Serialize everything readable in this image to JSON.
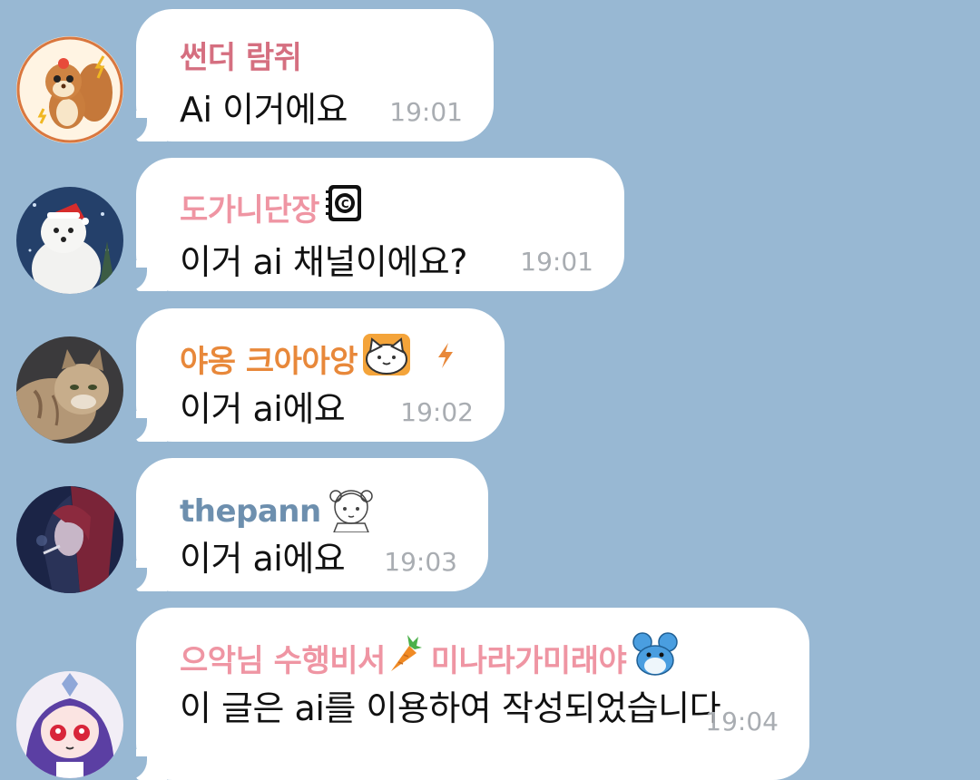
{
  "colors": {
    "background": "#98b8d3",
    "bubble": "#ffffff",
    "time": "#a9adb2",
    "sender_pink_dark": "#d56f80",
    "sender_pink_light": "#ef95a3",
    "sender_orange": "#e8883a",
    "sender_blue": "#6d8fae"
  },
  "messages": [
    {
      "sender": "썬더 람쥐",
      "sender_color": "#d56f80",
      "avatar": "squirrel-avatar",
      "text": "Ai 이거에요",
      "time": "19:01"
    },
    {
      "sender": "도가니단장",
      "sender_color": "#ef95a3",
      "avatar": "white-dog-avatar",
      "sender_emoji": "coin-notebook-icon",
      "text": "이거 ai 채널이에요?",
      "time": "19:01"
    },
    {
      "sender": "야옹 크아아앙",
      "sender_color": "#e8883a",
      "avatar": "cat-photo-avatar",
      "sender_emoji": "cat-face-icon",
      "sender_extra": "lightning-icon",
      "text": "이거 ai에요",
      "time": "19:02"
    },
    {
      "sender": "thepann",
      "sender_color": "#6d8fae",
      "avatar": "anime-girl-avatar",
      "sender_emoji": "sketch-girl-icon",
      "text": "이거 ai에요",
      "time": "19:03"
    },
    {
      "sender": "으악님 수행비서",
      "sender_color": "#ef95a3",
      "sender_emoji": "carrot-icon",
      "sender_suffix": "미나라가미래야",
      "sender_emoji2": "blue-mouse-icon",
      "avatar": "anime-chibi-avatar",
      "text": "이 글은 ai를 이용하여 작성되었습니다",
      "time": "19:04"
    }
  ]
}
